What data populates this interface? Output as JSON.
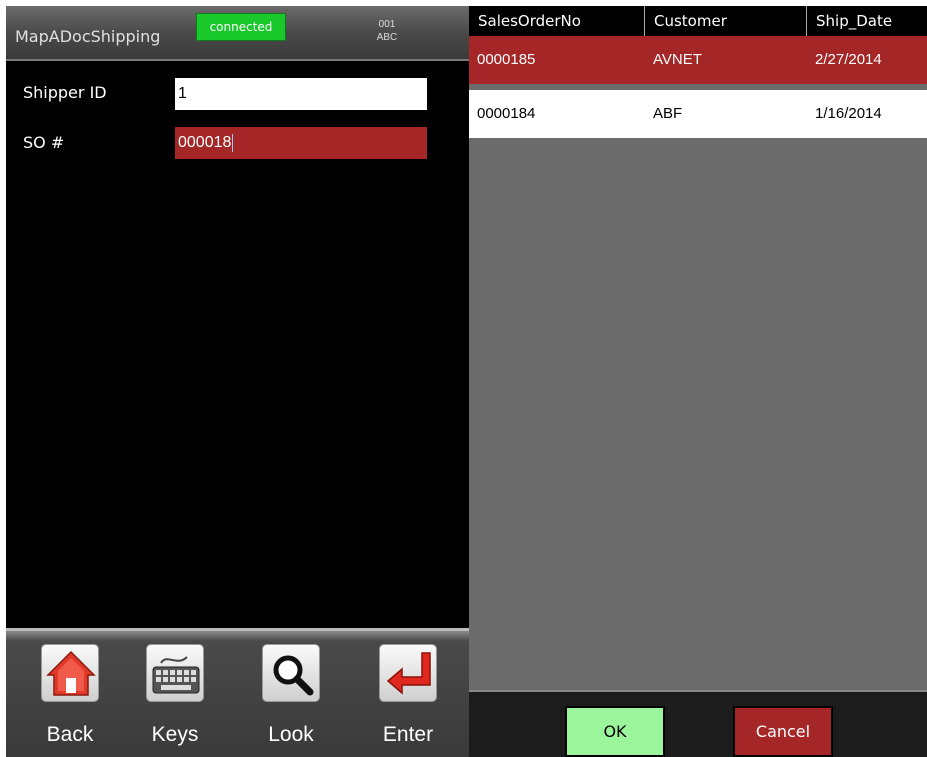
{
  "app": {
    "title": "MapADocShipping",
    "status_badge": "connected",
    "mode_line1": "001",
    "mode_line2": "ABC"
  },
  "form": {
    "shipper_label": "Shipper ID",
    "shipper_value": "1",
    "so_label": "SO #",
    "so_value": "000018"
  },
  "toolbar": {
    "buttons": [
      {
        "label": "Back",
        "icon": "home-icon"
      },
      {
        "label": "Keys",
        "icon": "keyboard-icon"
      },
      {
        "label": "Look",
        "icon": "magnifier-icon"
      },
      {
        "label": "Enter",
        "icon": "enter-arrow-icon"
      }
    ]
  },
  "grid": {
    "columns": [
      "SalesOrderNo",
      "Customer",
      "Ship_Date"
    ],
    "rows": [
      {
        "order": "0000185",
        "customer": "AVNET",
        "date": "2/27/2014",
        "selected": true
      },
      {
        "order": "0000184",
        "customer": "ABF",
        "date": "1/16/2014",
        "selected": false
      }
    ]
  },
  "dialog": {
    "ok_label": "OK",
    "cancel_label": "Cancel"
  },
  "colors": {
    "selected_row": "#a52626",
    "connected": "#19c82a",
    "ok": "#9bf59b",
    "cancel": "#a52626"
  }
}
